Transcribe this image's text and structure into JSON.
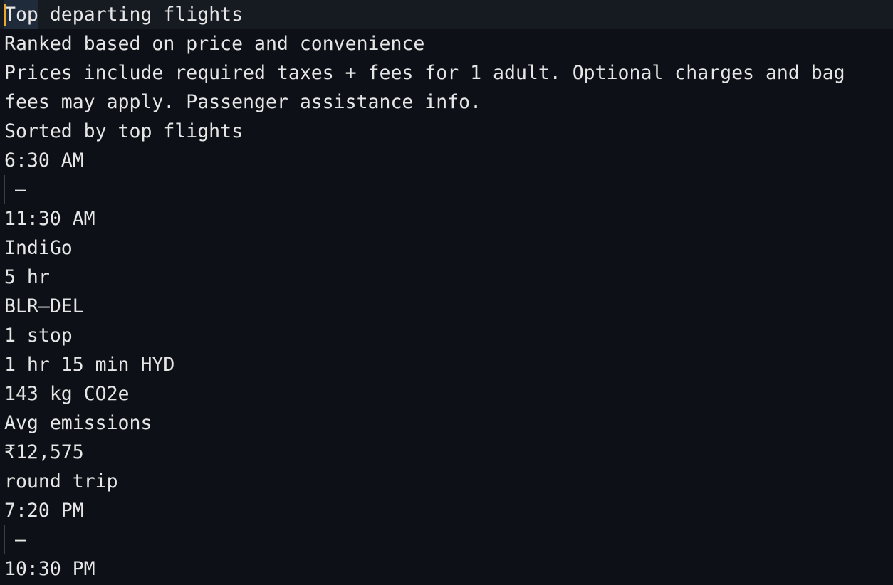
{
  "lines": [
    "Top departing flights",
    "Ranked based on price and convenience",
    "Prices include required taxes + fees for 1 adult. Optional charges and bag",
    "fees may apply. Passenger assistance info.",
    "Sorted by top flights",
    "6:30 AM",
    "–",
    "11:30 AM",
    "IndiGo",
    "5 hr",
    "BLR–DEL",
    "1 stop",
    "1 hr 15 min HYD",
    "143 kg CO2e",
    "Avg emissions",
    "₹12,575",
    "round trip",
    "7:20 PM",
    "–",
    "10:30 PM"
  ],
  "first_line": {
    "selected_word": "Top",
    "rest": " departing flights"
  },
  "colors": {
    "background": "#0d1117",
    "current_line": "#161b22",
    "text": "#e6e6e6",
    "cursor": "#e8a92e",
    "selection": "#1f2a3a",
    "indent_guide": "#3a3f47"
  }
}
